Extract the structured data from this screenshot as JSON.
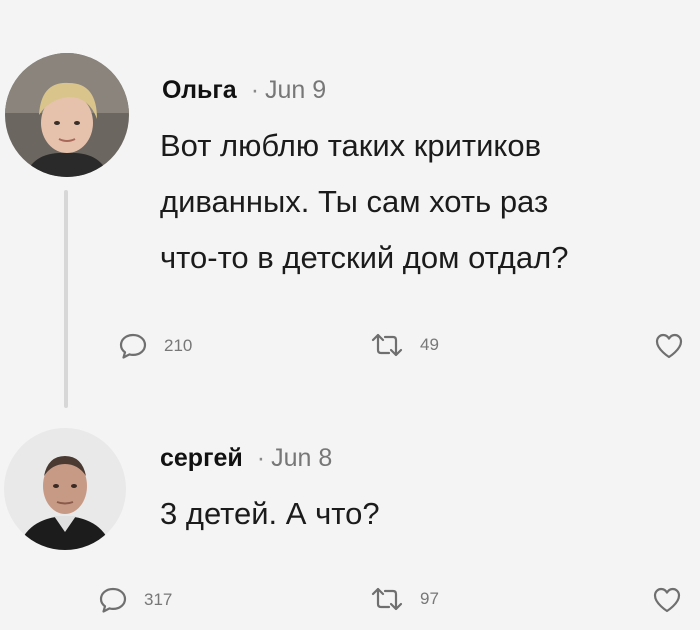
{
  "tweets": [
    {
      "author": "Ольга",
      "separator": "·",
      "date": "Jun 9",
      "text_lines": [
        "Вот люблю таких критиков",
        "диванных. Ты сам хоть раз",
        "что-то в детский дом отдал?"
      ],
      "reply_count": "210",
      "retweet_count": "49"
    },
    {
      "author": "сергей",
      "separator": "·",
      "date": "Jun 8",
      "text_lines": [
        "3 детей. А что?"
      ],
      "reply_count": "317",
      "retweet_count": "97"
    }
  ],
  "icons": {
    "reply": "speech-bubble-icon",
    "retweet": "retweet-arrows-icon",
    "like": "heart-icon"
  },
  "colors": {
    "background": "#f4f4f4",
    "text": "#1b1b1b",
    "muted": "#777777",
    "thread_line": "#d7d7d7"
  }
}
